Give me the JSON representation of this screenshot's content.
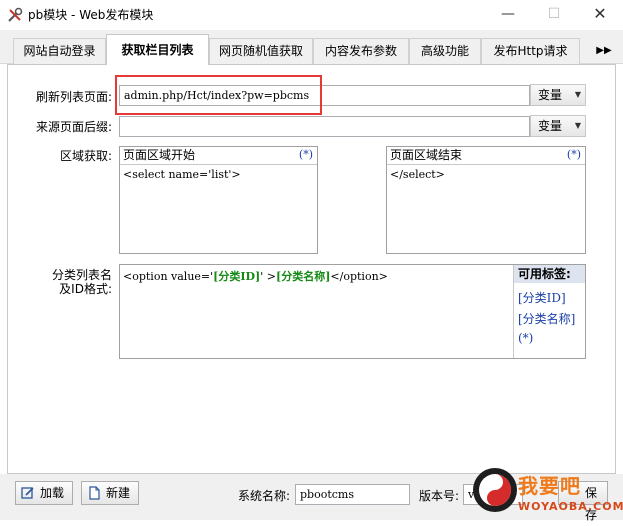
{
  "window": {
    "title": "pb模块 - Web发布模块",
    "min": "—",
    "max": "☐",
    "close": "✕"
  },
  "tabs": [
    {
      "label": "网站自动登录"
    },
    {
      "label": "获取栏目列表"
    },
    {
      "label": "网页随机值获取"
    },
    {
      "label": "内容发布参数"
    },
    {
      "label": "高级功能"
    },
    {
      "label": "发布Http请求"
    }
  ],
  "tab_scroll": "▶▶",
  "form": {
    "refresh_label": "刷新列表页面:",
    "refresh_value": "admin.php/Hct/index?pw=pbcms",
    "variable_btn": "变量",
    "source_suffix_label": "来源页面后缀:",
    "source_suffix_value": "",
    "region_label": "区域获取:",
    "region_start_title": "页面区域开始",
    "region_start_value": "<select name='list'>",
    "region_end_title": "页面区域结束",
    "region_end_value": "</select>",
    "star": "(*)",
    "format_label_1": "分类列表名",
    "format_label_2": "及ID格式:",
    "format_parts": [
      "<option value='",
      "[分类ID]",
      "' >",
      "[分类名称]",
      "</option>"
    ]
  },
  "tags": {
    "title": "可用标签:",
    "items": [
      "[分类ID]",
      "[分类名称]",
      "(*)"
    ]
  },
  "bottom": {
    "load_btn": "加载",
    "new_btn": "新建",
    "system_label": "系统名称:",
    "system_value": "pbootcms",
    "version_label": "版本号:",
    "version_value": "v",
    "save_btn": "保存"
  },
  "watermark": {
    "text": "我要吧",
    "sub": "WOYAOBA.COM"
  }
}
